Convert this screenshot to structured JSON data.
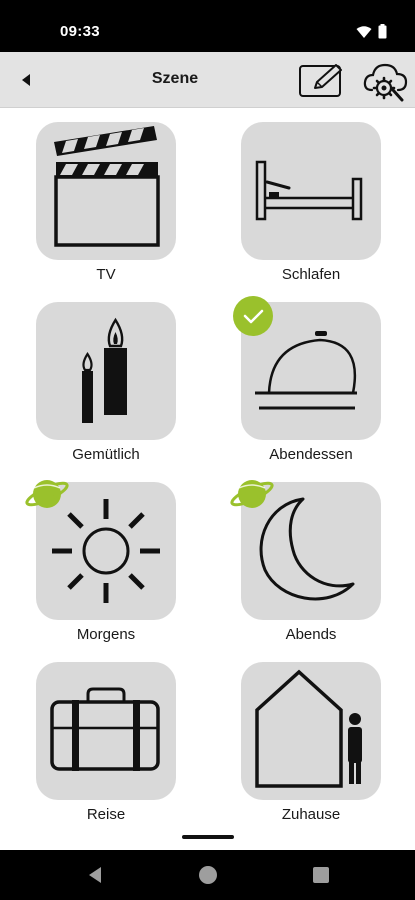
{
  "status_bar": {
    "time": "09:33",
    "icons": [
      "wifi-icon",
      "battery-icon"
    ]
  },
  "app_bar": {
    "title": "Szene",
    "back_icon": "back-arrow-icon",
    "edit_icon": "edit-icon",
    "cloud_icon": "cloud-settings-icon"
  },
  "scenes": [
    {
      "label": "TV",
      "icon": "clapperboard-icon",
      "badge": null
    },
    {
      "label": "Schlafen",
      "icon": "bed-icon",
      "badge": null
    },
    {
      "label": "Gemütlich",
      "icon": "candles-icon",
      "badge": null
    },
    {
      "label": "Abendessen",
      "icon": "cloche-icon",
      "badge": "active-check-icon"
    },
    {
      "label": "Morgens",
      "icon": "sun-icon",
      "badge": "planet-icon"
    },
    {
      "label": "Abends",
      "icon": "moon-icon",
      "badge": "planet-icon"
    },
    {
      "label": "Reise",
      "icon": "suitcase-icon",
      "badge": null
    },
    {
      "label": "Zuhause",
      "icon": "house-person-icon",
      "badge": null
    }
  ],
  "colors": {
    "accent": "#9ac12c",
    "tile_bg": "#d9d9d9",
    "app_bar_bg": "#e3e3e3"
  },
  "nav_bar": {
    "buttons": [
      "nav-back-icon",
      "nav-home-icon",
      "nav-recents-icon"
    ]
  }
}
